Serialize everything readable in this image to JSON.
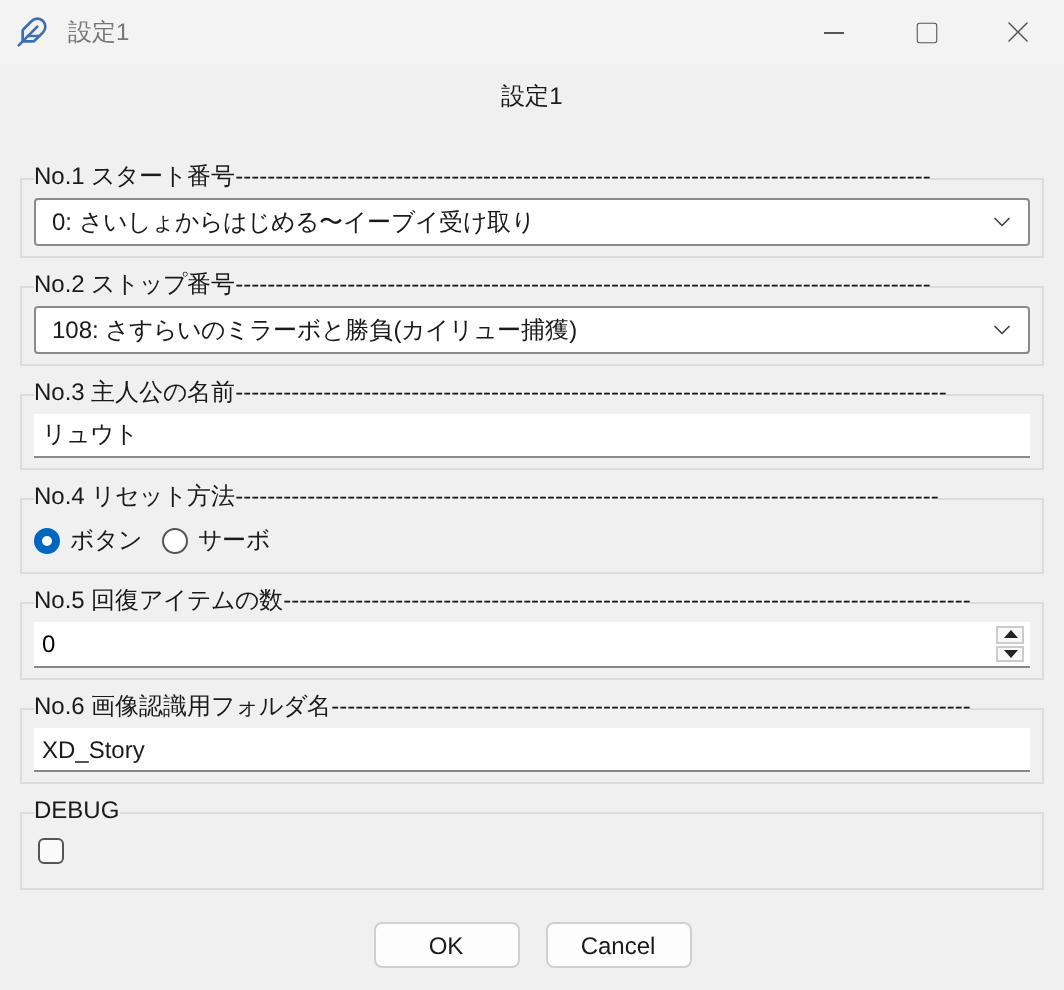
{
  "window": {
    "title": "設定1"
  },
  "heading": "設定1",
  "groups": [
    {
      "kind": "combo",
      "label": "No.1 スタート番号---------------------------------------------------------------------------------------",
      "value": "0: さいしょからはじめる〜イーブイ受け取り"
    },
    {
      "kind": "combo",
      "label": "No.2 ストップ番号---------------------------------------------------------------------------------------",
      "value": "108: さすらいのミラーボと勝負(カイリュー捕獲)"
    },
    {
      "kind": "text",
      "label": "No.3 主人公の名前-----------------------------------------------------------------------------------------",
      "value": "リュウト"
    },
    {
      "kind": "radio",
      "label": "No.4 リセット方法----------------------------------------------------------------------------------------",
      "options": [
        {
          "label": "ボタン",
          "selected": true
        },
        {
          "label": "サーボ",
          "selected": false
        }
      ]
    },
    {
      "kind": "spin",
      "label": "No.5 回復アイテムの数--------------------------------------------------------------------------------------",
      "value": "0"
    },
    {
      "kind": "text",
      "label": "No.6 画像認識用フォルダ名--------------------------------------------------------------------------------",
      "value": "XD_Story"
    },
    {
      "kind": "check",
      "label": "DEBUG",
      "checked": false
    }
  ],
  "buttons": [
    "OK",
    "Cancel"
  ]
}
